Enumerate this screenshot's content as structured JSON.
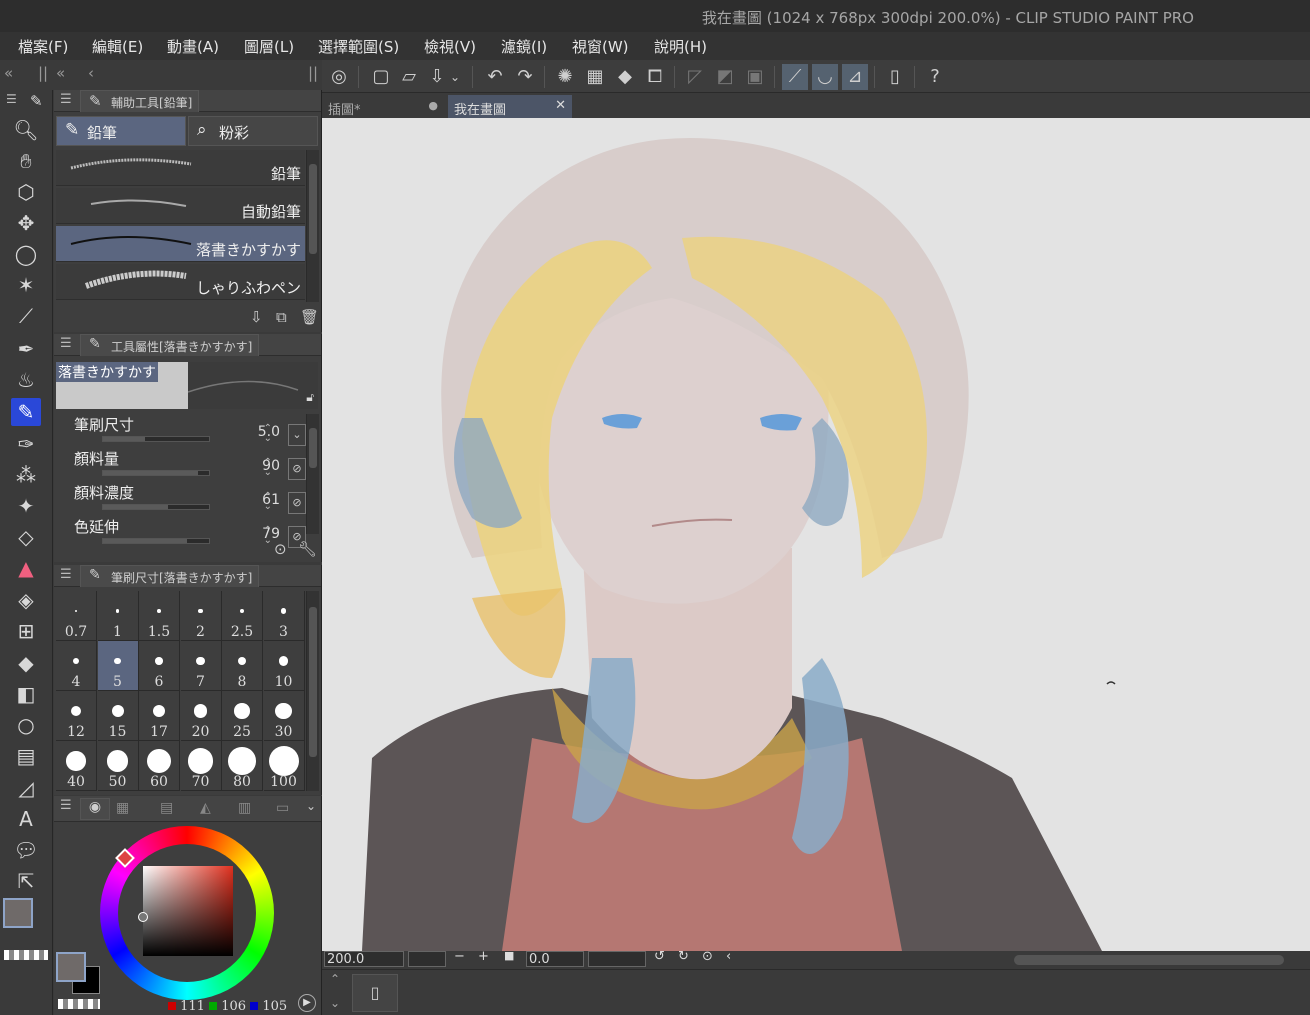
{
  "window": {
    "title": "我在畫圖 (1024 x 768px 300dpi 200.0%)  - CLIP STUDIO PAINT PRO"
  },
  "menu": [
    "檔案(F)",
    "編輯(E)",
    "動畫(A)",
    "圖層(L)",
    "選擇範圍(S)",
    "檢視(V)",
    "濾鏡(I)",
    "視窗(W)",
    "說明(H)"
  ],
  "subtool_panel": {
    "title": "輔助工具[鉛筆]",
    "tabs": [
      "鉛筆",
      "粉彩"
    ],
    "brushes": [
      "鉛筆",
      "自動鉛筆",
      "落書きかすかす",
      "しゃりふわペン"
    ]
  },
  "tool_property": {
    "title": "工具屬性[落書きかすかす]",
    "preview_name": "落書きかすかす",
    "props": [
      {
        "label": "筆刷尺寸",
        "value": "5.0",
        "fill": 0.4
      },
      {
        "label": "顏料量",
        "value": "90",
        "fill": 0.9
      },
      {
        "label": "顏料濃度",
        "value": "61",
        "fill": 0.61
      },
      {
        "label": "色延伸",
        "value": "79",
        "fill": 0.79
      }
    ]
  },
  "brush_size": {
    "title": "筆刷尺寸[落書きかすかす]",
    "sizes": [
      "0.7",
      "1",
      "1.5",
      "2",
      "2.5",
      "3",
      "4",
      "5",
      "6",
      "7",
      "8",
      "10",
      "12",
      "15",
      "17",
      "20",
      "25",
      "30",
      "40",
      "50",
      "60",
      "70",
      "80",
      "100"
    ],
    "selected": "5"
  },
  "color": {
    "r": "111",
    "g": "106",
    "b": "105",
    "main": "#6f6a69",
    "sub": "#000000"
  },
  "doc_tabs": [
    "插圖*",
    "我在畫圖"
  ],
  "status": {
    "zoom": "200.0",
    "angle": "0.0"
  }
}
